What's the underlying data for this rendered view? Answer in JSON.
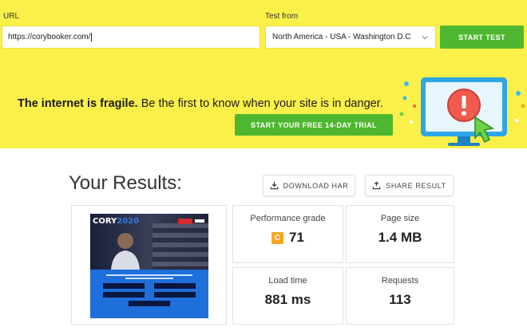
{
  "form": {
    "url_label": "URL",
    "url_value": "https://corybooker.com/",
    "test_from_label": "Test from",
    "test_from_value": "North America - USA - Washington D.C",
    "start_button": "START TEST"
  },
  "banner": {
    "text_bold": "The internet is fragile.",
    "text_rest": " Be the first to know when your site is in danger.",
    "cta": "START YOUR FREE 14-DAY TRIAL"
  },
  "results": {
    "title": "Your Results:",
    "download_button": "DOWNLOAD HAR",
    "share_button": "SHARE RESULT",
    "metrics": {
      "performance_grade_label": "Performance grade",
      "performance_grade_letter": "C",
      "performance_grade_value": "71",
      "page_size_label": "Page size",
      "page_size_value": "1.4 MB",
      "load_time_label": "Load time",
      "load_time_value": "881 ms",
      "requests_label": "Requests",
      "requests_value": "113"
    }
  },
  "thumbnail": {
    "logo_prefix": "CORY",
    "logo_suffix": "2020"
  },
  "colors": {
    "brand_yellow": "#fbf04a",
    "cta_green": "#4fb72f",
    "grade_orange": "#f5a623",
    "monitor_blue": "#2fa6e8",
    "alert_red": "#f25a4e"
  },
  "icons": [
    "chevron-down-icon",
    "download-icon",
    "share-icon",
    "monitor-alert-illustration"
  ]
}
